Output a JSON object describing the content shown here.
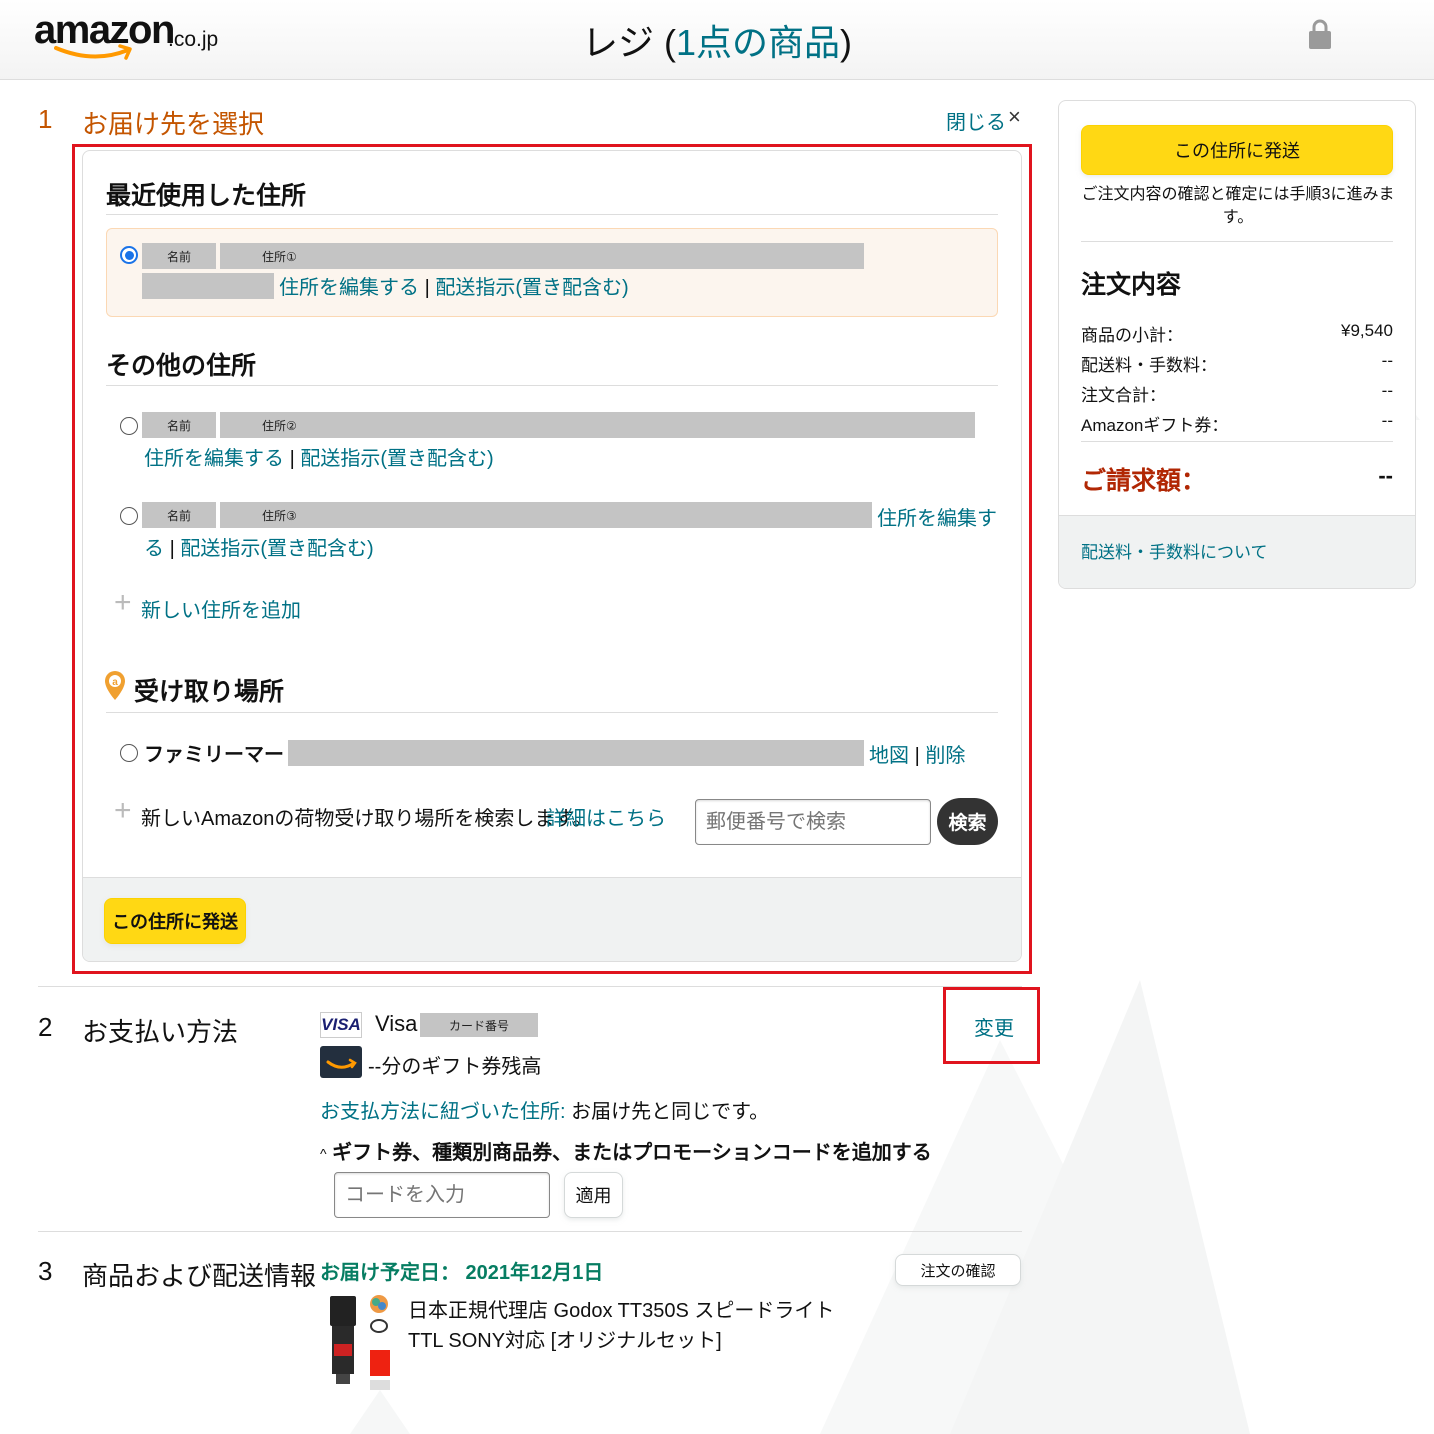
{
  "header": {
    "logo_text": "amazon",
    "logo_suffix": ".co.jp",
    "title_prefix": "レジ (",
    "title_link": "1点の商品",
    "title_suffix": ")"
  },
  "step1": {
    "number": "1",
    "title": "お届け先を選択",
    "close_label": "閉じる",
    "close_symbol": "×",
    "recent_heading": "最近使用した住所",
    "other_heading": "その他の住所",
    "pickup_heading": "受け取り場所",
    "addresses": [
      {
        "name_label": "名前",
        "address_label": "住所①",
        "edit_link": "住所を編集する",
        "separator": "|",
        "instruction_link": "配送指示(置き配含む)",
        "selected": true
      },
      {
        "name_label": "名前",
        "address_label": "住所②",
        "edit_link": "住所を編集する",
        "separator": "|",
        "instruction_link": "配送指示(置き配含む)",
        "selected": false
      },
      {
        "name_label": "名前",
        "address_label": "住所③",
        "edit_link_part1": "住所を編集す",
        "edit_link_part2": "る",
        "separator": "|",
        "instruction_link": "配送指示(置き配含む)",
        "selected": false
      }
    ],
    "add_address_label": "新しい住所を追加",
    "pickup_location": {
      "name": "ファミリーマート",
      "map_link": "地図",
      "separator": "|",
      "delete_link": "削除"
    },
    "pickup_search_text": "新しいAmazonの荷物受け取り場所を検索します。",
    "pickup_details_link": "詳細はこちら",
    "postal_placeholder": "郵便番号で検索",
    "search_button": "検索",
    "ship_button": "この住所に発送"
  },
  "sidebar": {
    "ship_button": "この住所に発送",
    "note": "ご注文内容の確認と確定には手順3に進みます。",
    "order_title": "注文内容",
    "rows": [
      {
        "label": "商品の小計：",
        "value": "¥9,540"
      },
      {
        "label": "配送料・手数料：",
        "value": "--"
      },
      {
        "label": "注文合計：",
        "value": "--"
      },
      {
        "label": "Amazonギフト券：",
        "value": "--"
      }
    ],
    "total_label": "ご請求額：",
    "total_value": "--",
    "shipping_link": "配送料・手数料について"
  },
  "step2": {
    "number": "2",
    "title": "お支払い方法",
    "card_brand_logo": "VISA",
    "card_brand": "Visa",
    "card_number_label": "カード番号",
    "gift_balance": "--分のギフト券残高",
    "billing_link": "お支払方法に紐づいた住所:",
    "billing_text": " お届け先と同じです。",
    "promo_toggle": "ギフト券、種類別商品券、またはプロモーションコードを追加する",
    "promo_chevron": "^",
    "code_placeholder": "コードを入力",
    "apply_button": "適用",
    "change_link": "変更"
  },
  "step3": {
    "number": "3",
    "title": "商品および配送情報",
    "delivery_date": "お届け予定日： 2021年12月1日",
    "confirm_button": "注文の確認",
    "product_name": "日本正規代理店 Godox TT350S スピードライト TTL SONY対応 [オリジナルセット]"
  },
  "colors": {
    "accent_orange": "#c45500",
    "link": "#007185",
    "yellow_button": "#ffd814",
    "highlight_red": "#e0141e",
    "price_red": "#b12704",
    "delivery_green": "#067d62"
  }
}
